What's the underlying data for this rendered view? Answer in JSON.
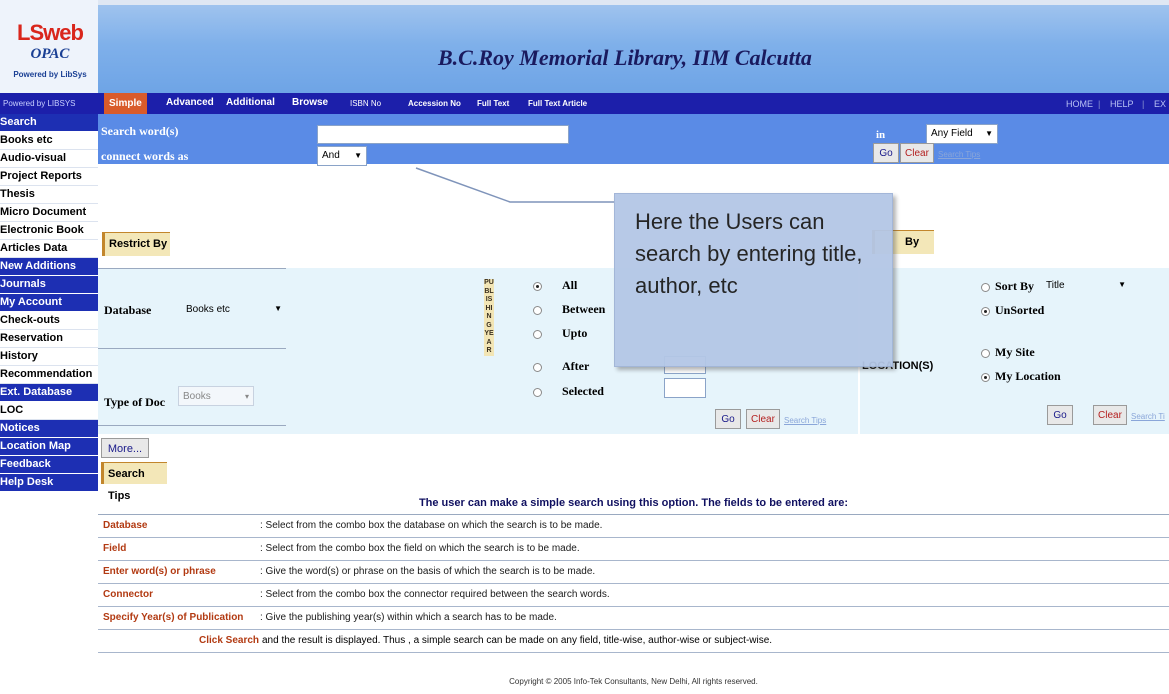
{
  "logo": {
    "word": "LSweb",
    "sub": "OPAC",
    "powered": "Powered by LibSys"
  },
  "banner": {
    "title": "B.C.Roy Memorial Library, IIM Calcutta"
  },
  "nav": {
    "powered_by": "Powered by LIBSYS",
    "tabs": [
      "Simple",
      "Advanced",
      "Additional",
      "Browse",
      "ISBN No",
      "Accession No",
      "Full Text",
      "Full Text Article"
    ],
    "right": [
      "HOME",
      "HELP",
      "EX"
    ]
  },
  "sidebar": {
    "items": [
      "Search",
      "Books etc",
      "Audio-visual",
      "Project Reports",
      "Thesis",
      "Micro Document",
      "Electronic Book",
      "Articles Data",
      "New Additions",
      "Journals",
      "My Account",
      "Check-outs",
      "Reservation",
      "History",
      "Recommendation",
      "Ext. Database",
      "LOC",
      "Notices",
      "Location Map",
      "Feedback",
      "Help Desk"
    ]
  },
  "search": {
    "word_label": "Search word(s)",
    "connect_label": "connect words as",
    "connect_value": "And",
    "in_label": "in",
    "field_value": "Any Field",
    "go": "Go",
    "clear": "Clear",
    "tips": "Search Tips"
  },
  "restrict": {
    "header": "Restrict By",
    "database_label": "Database",
    "database_value": "Books etc",
    "type_label": "Type of Doc",
    "type_value": "Books",
    "more": "More...",
    "pub_year": "PUBLISHINGYEAR",
    "options": [
      "All",
      "Between",
      "Upto",
      "After",
      "Selected"
    ],
    "go": "Go",
    "clear": "Clear",
    "tips": "Search Tips"
  },
  "sort": {
    "header": "By",
    "sort_by_label": "Sort By",
    "sort_value": "Title",
    "unsorted": "UnSorted",
    "location_label": "LOCATION(S)",
    "my_site": "My Site",
    "my_location": "My Location",
    "go": "Go",
    "clear": "Clear",
    "tips": "Search Ti"
  },
  "callout": {
    "text": "Here the Users can search by entering title, author, etc"
  },
  "search_tips": {
    "header": "Search Tips",
    "intro": "The user can make a simple search using this option. The fields to be entered are:",
    "rows": [
      {
        "key": "Database",
        "value": ": Select from the combo box the database on which the search is to be made."
      },
      {
        "key": "Field",
        "value": ": Select from the combo box the field on which the search is to be made."
      },
      {
        "key": "Enter word(s) or phrase",
        "value": ": Give the word(s) or phrase on the basis of which the search is to be made."
      },
      {
        "key": "Connector",
        "value": ": Select from the combo box the connector required between the search words."
      },
      {
        "key": "Specify Year(s) of Publication",
        "value": ": Give the publishing year(s) within which a search has to be made."
      }
    ],
    "click_search": "Click Search",
    "footer_line": "and the result is displayed. Thus , a simple search can be made on any field, title-wise, author-wise or subject-wise."
  },
  "copyright": "Copyright © 2005 Info-Tek Consultants, New Delhi, All rights reserved."
}
